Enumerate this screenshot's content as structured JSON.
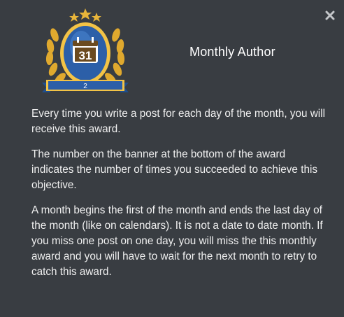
{
  "dialog": {
    "title": "Monthly Author",
    "badge": {
      "calendar_day": "31",
      "banner_count": "2",
      "stars": 3
    },
    "paragraphs": [
      "Every time you write a post for each day of the month, you will receive this award.",
      "The number on the banner at the bottom of the award indicates the number of times you succeeded to achieve this objective.",
      "A month begins the first of the month and ends the last day of the month (like on calendars). It is not a date to date month. If you miss one post on one day, you will miss the this monthly award and you will have to wait for the next month to retry to catch this award."
    ],
    "close_icon": "close-icon"
  },
  "colors": {
    "background": "#393d42",
    "gold": "#e8b53a",
    "badge_blue": "#2c5fa8",
    "text": "#f0f0f0"
  }
}
